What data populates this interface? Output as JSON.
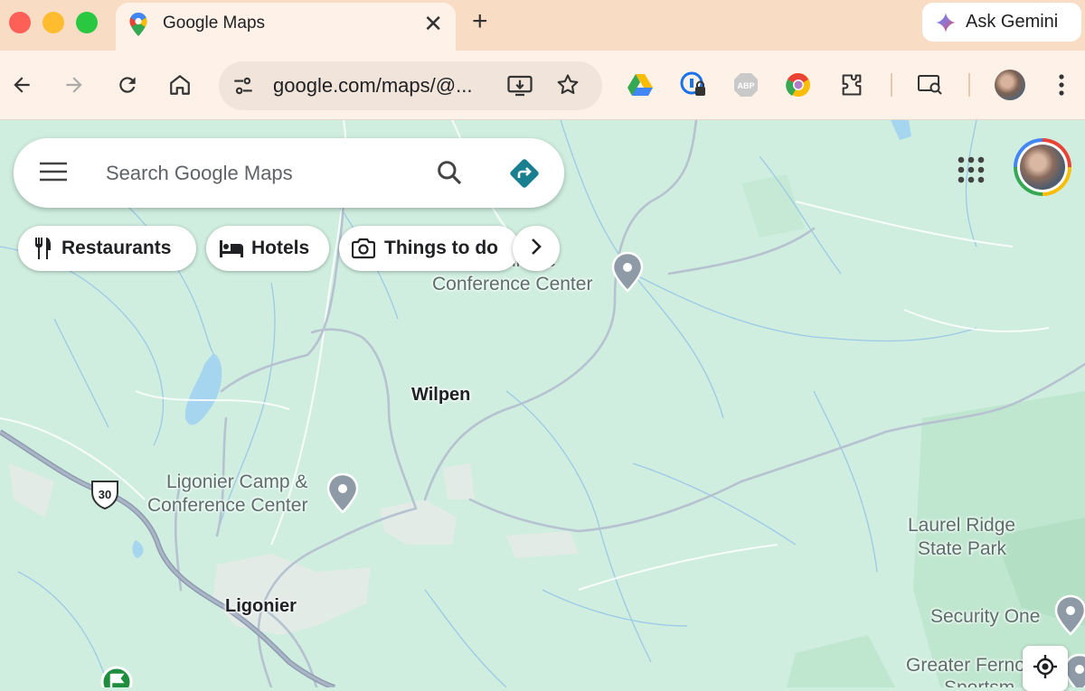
{
  "browser": {
    "tab": {
      "title": "Google Maps",
      "favicon": "google-maps-pin-icon"
    },
    "gemini_label": "Ask Gemini",
    "omnibox": {
      "url": "google.com/maps/@..."
    },
    "icons": [
      "back-arrow-icon",
      "forward-arrow-icon",
      "reload-icon",
      "home-icon",
      "site-settings-icon",
      "install-app-icon",
      "star-icon",
      "google-drive-icon",
      "password-manager-icon",
      "adblock-plus-icon",
      "chrome-extension-icon",
      "extensions-puzzle-icon",
      "search-tabs-icon",
      "profile-avatar-icon",
      "more-vert-icon"
    ]
  },
  "search": {
    "placeholder": "Search Google Maps"
  },
  "chips": [
    {
      "label": "Restaurants",
      "icon": "fork-knife-icon"
    },
    {
      "label": "Hotels",
      "icon": "bed-icon"
    },
    {
      "label": "Things to do",
      "icon": "camera-icon"
    }
  ],
  "map": {
    "labels": [
      {
        "text": "Village",
        "visible_text": "illage"
      },
      {
        "text": "Conference Center"
      },
      {
        "text": "Wilpen"
      },
      {
        "text": "Ligonier Camp &"
      },
      {
        "text": "Conference Center"
      },
      {
        "text": "Ligonier"
      },
      {
        "text": "Laurel Ridge"
      },
      {
        "text": "State Park"
      },
      {
        "text": "Security One"
      },
      {
        "text": "Greater Ferno"
      },
      {
        "text": "Sportsm"
      }
    ],
    "route_shield": "30",
    "colors": {
      "land": "#cfeee0",
      "forest": "#bfe6cf",
      "water": "#a5d5ef",
      "road": "#b6c2cf",
      "pin": "#8e9aa6"
    }
  }
}
